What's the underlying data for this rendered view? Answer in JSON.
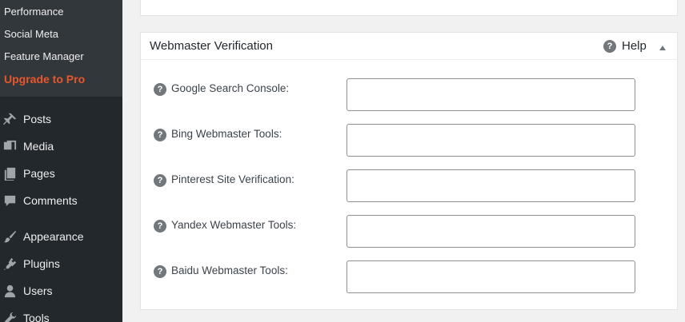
{
  "sidebar": {
    "submenu": [
      {
        "label": "Performance"
      },
      {
        "label": "Social Meta"
      },
      {
        "label": "Feature Manager"
      },
      {
        "label": "Upgrade to Pro"
      }
    ],
    "menu": [
      {
        "label": "Posts",
        "icon": "pin-icon"
      },
      {
        "label": "Media",
        "icon": "media-icon"
      },
      {
        "label": "Pages",
        "icon": "pages-icon"
      },
      {
        "label": "Comments",
        "icon": "comment-icon"
      },
      {
        "label": "Appearance",
        "icon": "brush-icon"
      },
      {
        "label": "Plugins",
        "icon": "plugin-icon"
      },
      {
        "label": "Users",
        "icon": "user-icon"
      },
      {
        "label": "Tools",
        "icon": "wrench-icon"
      }
    ],
    "accent_color": "#e8572b"
  },
  "panel": {
    "title": "Webmaster Verification",
    "help_label": "Help",
    "fields": [
      {
        "label": "Google Search Console:",
        "value": ""
      },
      {
        "label": "Bing Webmaster Tools:",
        "value": ""
      },
      {
        "label": "Pinterest Site Verification:",
        "value": ""
      },
      {
        "label": "Yandex Webmaster Tools:",
        "value": ""
      },
      {
        "label": "Baidu Webmaster Tools:",
        "value": ""
      }
    ]
  }
}
